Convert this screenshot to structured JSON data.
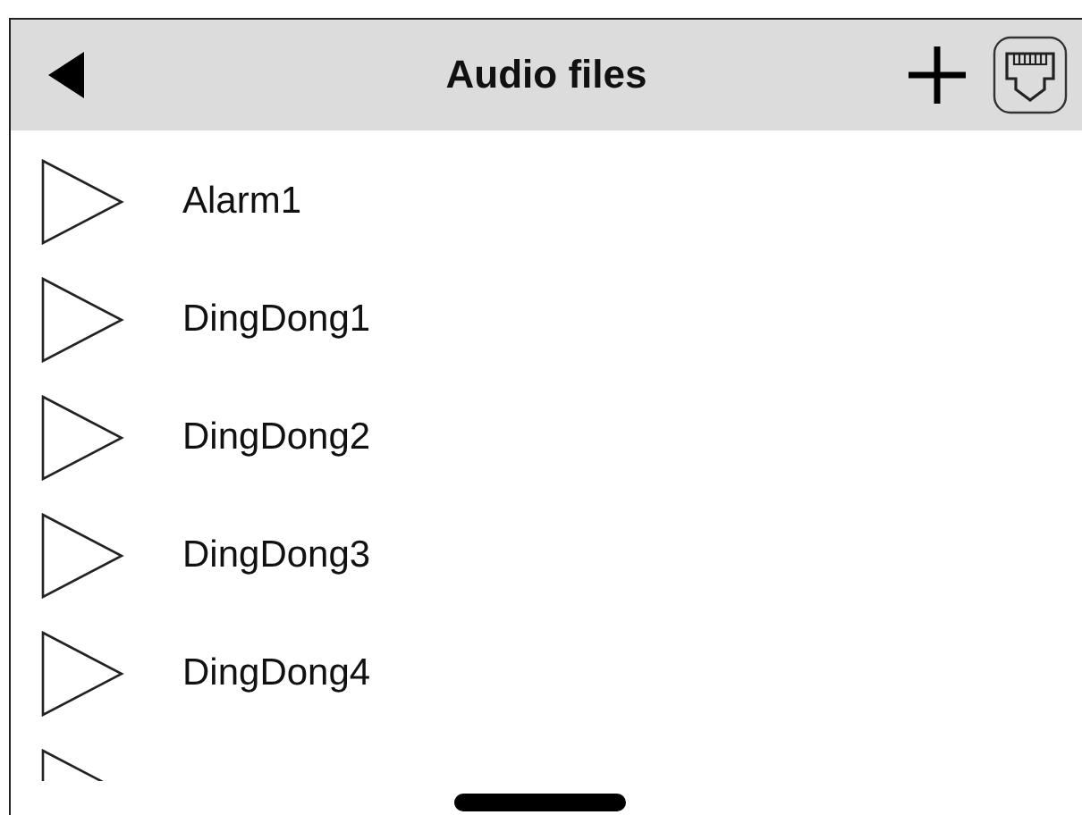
{
  "header": {
    "title": "Audio files"
  },
  "files": [
    {
      "name": "Alarm1"
    },
    {
      "name": "DingDong1"
    },
    {
      "name": "DingDong2"
    },
    {
      "name": "DingDong3"
    },
    {
      "name": "DingDong4"
    }
  ]
}
